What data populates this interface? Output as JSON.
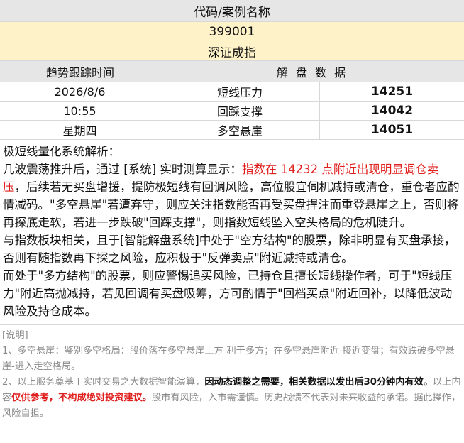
{
  "header": {
    "title": "代码/案例名称",
    "code": "399001",
    "name": "深证成指"
  },
  "subheader": {
    "left": "趋势跟踪时间",
    "right": "解 盘 数 据"
  },
  "rows": [
    {
      "a": "2026/8/6",
      "b": "短线压力",
      "c": "14251"
    },
    {
      "a": "10:55",
      "b": "回踩支撑",
      "c": "14042"
    },
    {
      "a": "星期四",
      "b": "多空悬崖",
      "c": "14051"
    }
  ],
  "analysis": {
    "title": "极短线量化系统解析：",
    "p1_pre": "几波震荡推升后，通过 [系统] 实时测算显示：",
    "p1_red": "指数在 14232 点附近出现明显调仓卖压",
    "p1_post": "，后续若无买盘增援，提防极短线有回调风险，高位股宜伺机减持或清仓，重仓者应酌情减码。\"多空悬崖\"若遭弃守，则应关注指数能否再受买盘捍注而重登悬崖之上，否则将再探底走软，若进一步跌破\"回踩支撑\"，则指数短线坠入空头格局的危机陡升。",
    "p2": "与指数板块相关，且于[智能解盘系统]中处于\"空方结构\"的股票，除非明显有买盘承接，否则有随指数再下探之风险，应积极于\"反弹卖点\"附近减持或清仓。",
    "p3": "而处于\"多方结构\"的股票，则应警惕追买风险，已持仓且擅长短线操作者，可于\"短线压力\"附近高抛减持，若见回调有买盘吸筹，方可酌情于\"回档买点\"附近回补，以降低波动风险及持仓成本。"
  },
  "notes": {
    "label": "[说明]",
    "n1": "1、多空悬崖：鉴别多空格局：股价落在多空悬崖上方-利于多方；在多空悬崖附近-接近变盘；有效跌破多空悬崖-进入走空格局。",
    "n2_pre": "2、以上服务奠基于实时交易之大数据智能演算，",
    "n2_bold": "因动态调整之需要，相关数据以发出后30分钟内有效。",
    "n2_mid": "以上内容",
    "n2_red": "仅供参考，不构成绝对投资建议。",
    "n2_post": "股市有风险，入市需谨慎。历史战绩不代表对未来收益的承诺。据此操作，风险自担。"
  }
}
